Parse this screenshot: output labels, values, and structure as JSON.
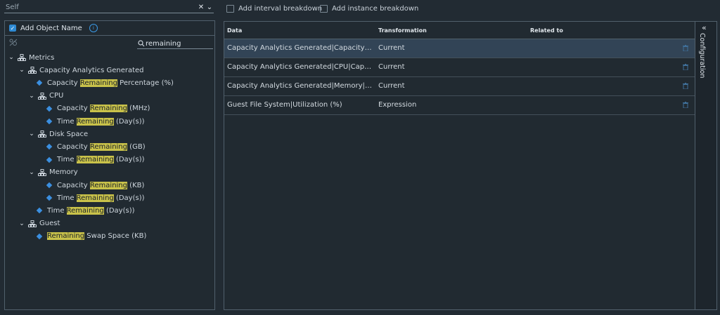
{
  "scope_select": {
    "value": "Self",
    "clear_icon": "✕",
    "chevron_icon": "⌄"
  },
  "left_panel": {
    "add_object_name_label": "Add Object Name",
    "search_value": "remaining",
    "tree": [
      {
        "id": "metrics",
        "label": "Metrics",
        "kind": "group"
      },
      {
        "id": "cag",
        "label": "Capacity Analytics Generated",
        "kind": "group"
      },
      {
        "id": "cag-crp",
        "pre": "Capacity ",
        "hl": "Remaining",
        "post": " Percentage (%)",
        "kind": "leaf"
      },
      {
        "id": "cpu",
        "label": "CPU",
        "kind": "group"
      },
      {
        "id": "cpu-cr",
        "pre": "Capacity ",
        "hl": "Remaining",
        "post": " (MHz)",
        "kind": "leaf"
      },
      {
        "id": "cpu-tr",
        "pre": "Time ",
        "hl": "Remaining",
        "post": " (Day(s))",
        "kind": "leaf"
      },
      {
        "id": "disk",
        "label": "Disk Space",
        "kind": "group"
      },
      {
        "id": "disk-cr",
        "pre": "Capacity ",
        "hl": "Remaining",
        "post": " (GB)",
        "kind": "leaf"
      },
      {
        "id": "disk-tr",
        "pre": "Time ",
        "hl": "Remaining",
        "post": " (Day(s))",
        "kind": "leaf"
      },
      {
        "id": "mem",
        "label": "Memory",
        "kind": "group"
      },
      {
        "id": "mem-cr",
        "pre": "Capacity ",
        "hl": "Remaining",
        "post": " (KB)",
        "kind": "leaf"
      },
      {
        "id": "mem-tr",
        "pre": "Time ",
        "hl": "Remaining",
        "post": " (Day(s))",
        "kind": "leaf"
      },
      {
        "id": "cag-tr",
        "pre": "Time ",
        "hl": "Remaining",
        "post": " (Day(s))",
        "kind": "leaf"
      },
      {
        "id": "guest",
        "label": "Guest",
        "kind": "group"
      },
      {
        "id": "guest-rss",
        "pre": "",
        "hl": "Remaining",
        "post": " Swap Space (KB)",
        "kind": "leaf"
      }
    ]
  },
  "toolbar": {
    "interval_breakdown_label": "Add interval breakdown",
    "instance_breakdown_label": "Add instance breakdown"
  },
  "table": {
    "headers": {
      "data": "Data",
      "transformation": "Transformation",
      "related_to": "Related to"
    },
    "rows": [
      {
        "data": "Capacity Analytics Generated|Capacity Remaining Percentage (%)",
        "transformation": "Current",
        "selected": true
      },
      {
        "data": "Capacity Analytics Generated|CPU|Capacity Remaining (MHz)",
        "transformation": "Current",
        "selected": false
      },
      {
        "data": "Capacity Analytics Generated|Memory|Capacity Remaining (KB)",
        "transformation": "Current",
        "selected": false
      },
      {
        "data": "Guest File System|Utilization (%)",
        "transformation": "Expression",
        "selected": false
      }
    ]
  },
  "config_tab": {
    "label": "Configuration",
    "collapse_icon": "«"
  },
  "colors": {
    "accent": "#2e8ad3",
    "highlight": "#c9c24a",
    "background": "#222b33",
    "selected_row": "#324456"
  }
}
